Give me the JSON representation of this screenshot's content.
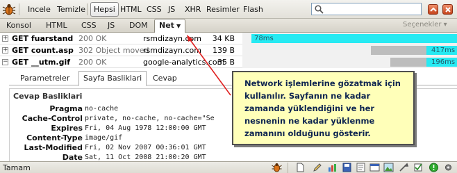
{
  "toolbar": {
    "inspect": "Incele",
    "clear": "Temizle",
    "filters": [
      {
        "label": "Hepsi",
        "active": true
      },
      {
        "label": "HTML"
      },
      {
        "label": "CSS"
      },
      {
        "label": "JS"
      },
      {
        "label": "XHR"
      },
      {
        "label": "Resimler"
      },
      {
        "label": "Flash"
      }
    ],
    "search_value": ""
  },
  "panels": {
    "tabs": [
      "Konsol",
      "HTML",
      "CSS",
      "JS",
      "DOM",
      "Net"
    ],
    "active_tab": "Net",
    "options_label": "Seçenekler ▾"
  },
  "requests": [
    {
      "method_url": "GET fuarstand",
      "status": "200 OK",
      "domain": "rsmdizayn.com",
      "size": "34 KB",
      "time": "78ms"
    },
    {
      "method_url": "GET count.asp",
      "status": "302 Object moved",
      "domain": "rsmdizayn.com",
      "size": "139 B",
      "time": "417ms"
    },
    {
      "method_url": "GET __utm.gif",
      "status": "200 OK",
      "domain": "google-analytics.com",
      "size": "35 B",
      "time": "196ms"
    }
  ],
  "detail": {
    "tabs": [
      "Parametreler",
      "Sayfa Basliklari",
      "Cevap"
    ],
    "active_tab": "Sayfa Basliklari",
    "section_title": "Cevap Basliklari",
    "headers": [
      {
        "key": "Pragma",
        "value": "no-cache"
      },
      {
        "key": "Cache-Control",
        "value": "private, no-cache, no-cache=\"Se"
      },
      {
        "key": "Expires",
        "value": "Fri, 04 Aug 1978 12:00:00 GMT"
      },
      {
        "key": "Content-Type",
        "value": "image/gif"
      },
      {
        "key": "Last-Modified",
        "value": "Fri, 02 Nov 2007 00:36:01 GMT"
      },
      {
        "key": "Date",
        "value": "Sat, 11 Oct 2008 21:00:20 GMT"
      }
    ]
  },
  "callout": {
    "text": "Network işlemlerine gözatmak için kullanılır. Sayfanın ne kadar zamanda yüklendiğini ve her nesnenin ne kadar yüklenme zamanını olduğunu gösterir."
  },
  "statusbar": {
    "text": "Tamam"
  },
  "colors": {
    "timeline_receive": "#27eaf2",
    "timeline_wait": "#bdbdbd",
    "callout_bg": "#ffffb9",
    "callout_text": "#0d2450",
    "arrow": "#e02020"
  }
}
